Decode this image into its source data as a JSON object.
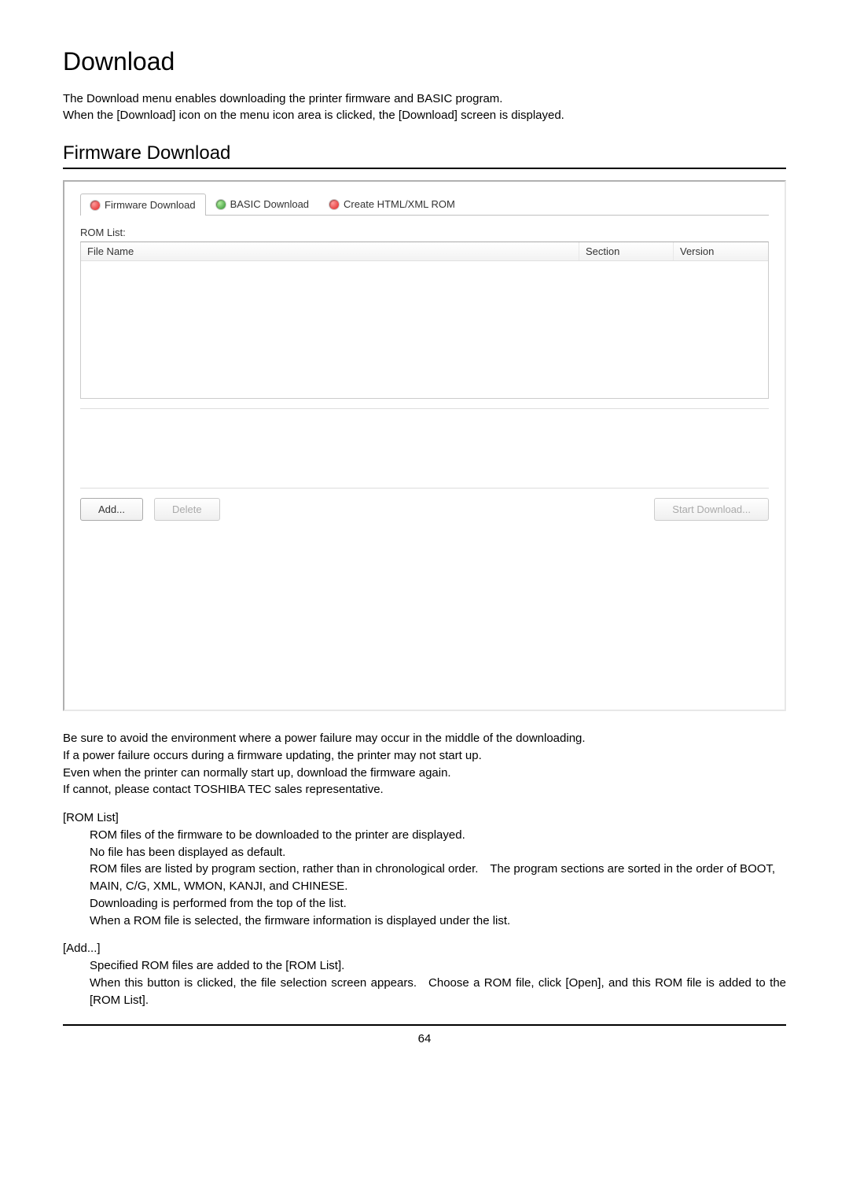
{
  "title": "Download",
  "intro": [
    "The Download menu enables downloading the printer firmware and BASIC program.",
    "When the [Download] icon on the menu icon area is clicked, the [Download] screen is displayed."
  ],
  "subsection": "Firmware Download",
  "tabs": {
    "firmware": "Firmware Download",
    "basic": "BASIC Download",
    "createrom": "Create HTML/XML ROM"
  },
  "romlist_label": "ROM List:",
  "columns": {
    "name": "File Name",
    "section": "Section",
    "version": "Version"
  },
  "buttons": {
    "add": "Add...",
    "delete": "Delete",
    "start": "Start Download..."
  },
  "warning_lines": [
    "Be sure to avoid the environment where a power failure may occur in the middle of the downloading.",
    "If a power failure occurs during a firmware updating, the printer may not start up.",
    "Even when the printer can normally start up, download the firmware again.",
    "If cannot, please contact TOSHIBA TEC sales representative."
  ],
  "romlist_heading": "[ROM List]",
  "romlist_desc": [
    "ROM files of the firmware to be downloaded to the printer are displayed.",
    "No file has been displayed as default.",
    "ROM files are listed by program section, rather than in chronological order. The program sections are sorted in the order of BOOT, MAIN, C/G, XML, WMON, KANJI, and CHINESE.",
    "Downloading is performed from the top of the list.",
    "When a ROM file is selected, the firmware information is displayed under the list."
  ],
  "add_heading": "[Add...]",
  "add_desc": [
    "Specified ROM files are added to the [ROM List].",
    "When this button is clicked, the file selection screen appears. Choose a ROM file, click [Open], and this ROM file is added to the [ROM List]."
  ],
  "page_number": "64"
}
